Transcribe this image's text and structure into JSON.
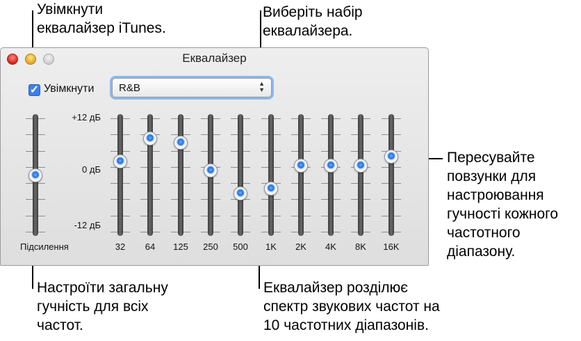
{
  "callouts": {
    "enable": "Увімкнути\nеквалайзер iTunes.",
    "preset": "Виберіть набір\nеквалайзера.",
    "sliders": "Пересувайте\nповзунки для\nнастроювання\nгучності кожного\nчастотного\nдіапазону.",
    "preamp": "Настроїти загальну\nгучність для всіх\nчастот.",
    "bands": "Еквалайзер розділює\nспектр звукових частот на\n10 частотних діапазонів."
  },
  "window": {
    "title": "Еквалайзер"
  },
  "controls": {
    "enable_label": "Увімкнути",
    "enabled": true,
    "preset_value": "R&B",
    "preset_arrows": "▲\n▼"
  },
  "scale": {
    "top": "+12 дБ",
    "mid": "0 дБ",
    "bottom": "-12 дБ",
    "min_db": -12,
    "max_db": 12
  },
  "preamp": {
    "label": "Підсилення",
    "level_db": 0
  },
  "bands": [
    {
      "label": "32",
      "level_db": 3
    },
    {
      "label": "64",
      "level_db": 8
    },
    {
      "label": "125",
      "level_db": 7
    },
    {
      "label": "250",
      "level_db": 1
    },
    {
      "label": "500",
      "level_db": -4
    },
    {
      "label": "1K",
      "level_db": -3
    },
    {
      "label": "2K",
      "level_db": 2
    },
    {
      "label": "4K",
      "level_db": 2
    },
    {
      "label": "8K",
      "level_db": 2
    },
    {
      "label": "16K",
      "level_db": 4
    }
  ]
}
